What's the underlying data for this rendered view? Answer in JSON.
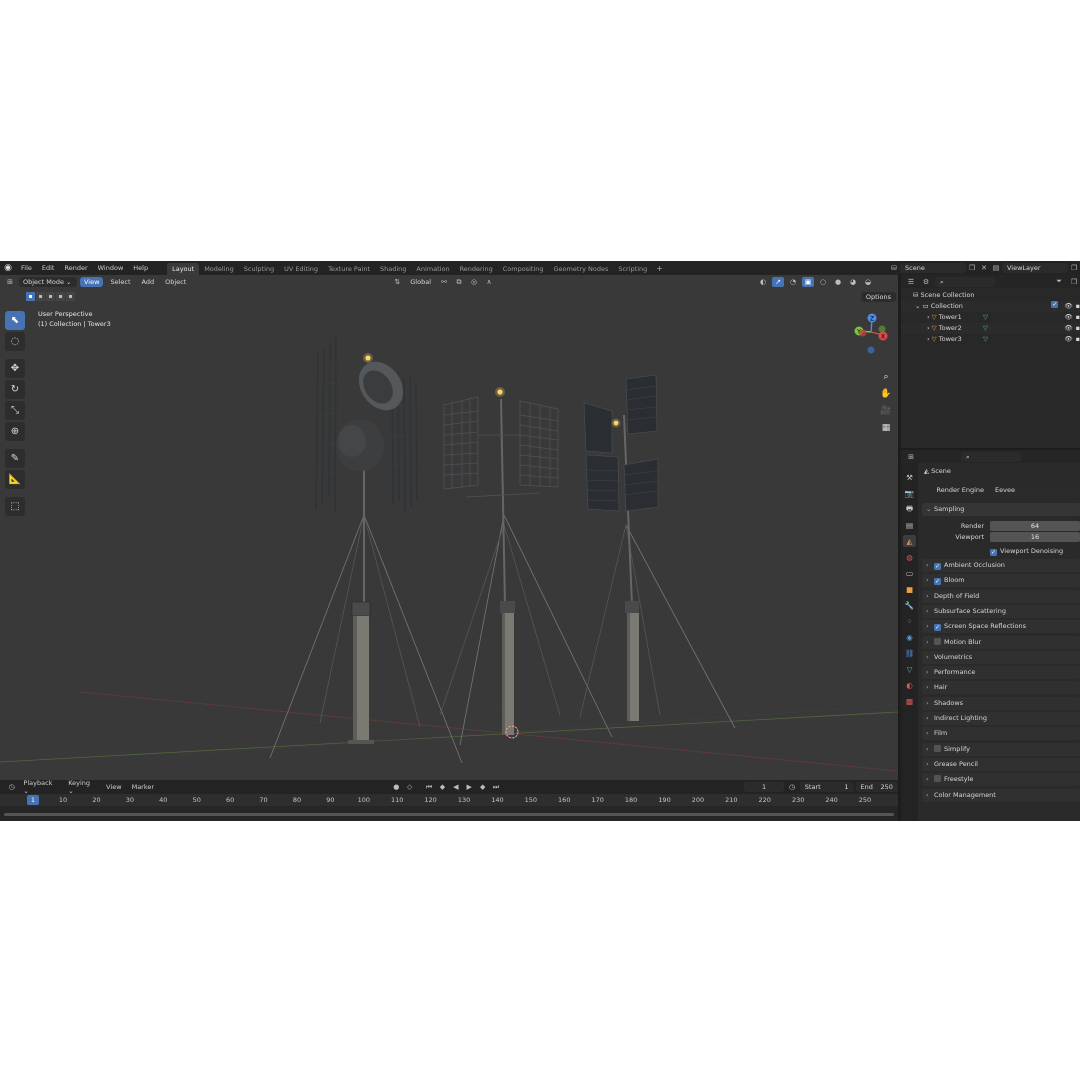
{
  "menubar": {
    "menus": [
      "File",
      "Edit",
      "Render",
      "Window",
      "Help"
    ],
    "workspaces": [
      "Layout",
      "Modeling",
      "Sculpting",
      "UV Editing",
      "Texture Paint",
      "Shading",
      "Animation",
      "Rendering",
      "Compositing",
      "Geometry Nodes",
      "Scripting"
    ],
    "active_workspace": "Layout",
    "scene": "Scene",
    "view_layer": "ViewLayer"
  },
  "viewport": {
    "mode": "Object Mode",
    "menus": [
      "View",
      "Select",
      "Add",
      "Object"
    ],
    "orientation": "Global",
    "options_label": "Options",
    "info_line1": "User Perspective",
    "info_line2": "(1) Collection | Tower3",
    "gizmo_axes": [
      "X",
      "Y",
      "Z"
    ]
  },
  "outliner": {
    "root": "Scene Collection",
    "collection": "Collection",
    "objects": [
      "Tower1",
      "Tower2",
      "Tower3"
    ]
  },
  "properties": {
    "context": "Scene",
    "render_engine_label": "Render Engine",
    "render_engine": "Eevee",
    "sampling": {
      "title": "Sampling",
      "render_label": "Render",
      "render_value": "64",
      "viewport_label": "Viewport",
      "viewport_value": "16",
      "denoise_label": "Viewport Denoising"
    },
    "panels": [
      {
        "label": "Ambient Occlusion",
        "checkbox": "on"
      },
      {
        "label": "Bloom",
        "checkbox": "on"
      },
      {
        "label": "Depth of Field",
        "checkbox": "none"
      },
      {
        "label": "Subsurface Scattering",
        "checkbox": "none"
      },
      {
        "label": "Screen Space Reflections",
        "checkbox": "on"
      },
      {
        "label": "Motion Blur",
        "checkbox": "off"
      },
      {
        "label": "Volumetrics",
        "checkbox": "none"
      },
      {
        "label": "Performance",
        "checkbox": "none"
      },
      {
        "label": "Hair",
        "checkbox": "none"
      },
      {
        "label": "Shadows",
        "checkbox": "none"
      },
      {
        "label": "Indirect Lighting",
        "checkbox": "none"
      },
      {
        "label": "Film",
        "checkbox": "none"
      },
      {
        "label": "Simplify",
        "checkbox": "off"
      },
      {
        "label": "Grease Pencil",
        "checkbox": "none"
      },
      {
        "label": "Freestyle",
        "checkbox": "off"
      },
      {
        "label": "Color Management",
        "checkbox": "none"
      }
    ]
  },
  "timeline": {
    "menus": [
      "Playback",
      "Keying",
      "View",
      "Marker"
    ],
    "current_frame": "1",
    "start_label": "Start",
    "start": "1",
    "end_label": "End",
    "end": "250",
    "ticks": [
      "1",
      "10",
      "20",
      "30",
      "40",
      "50",
      "60",
      "70",
      "80",
      "90",
      "100",
      "110",
      "120",
      "130",
      "140",
      "150",
      "160",
      "170",
      "180",
      "190",
      "200",
      "210",
      "220",
      "230",
      "240",
      "250"
    ]
  },
  "colors": {
    "accent": "#4772b3",
    "viewport_bg": "#393939",
    "x_axis": "#e0474c",
    "y_axis": "#7bc43b",
    "z_axis": "#4a8ee8"
  }
}
